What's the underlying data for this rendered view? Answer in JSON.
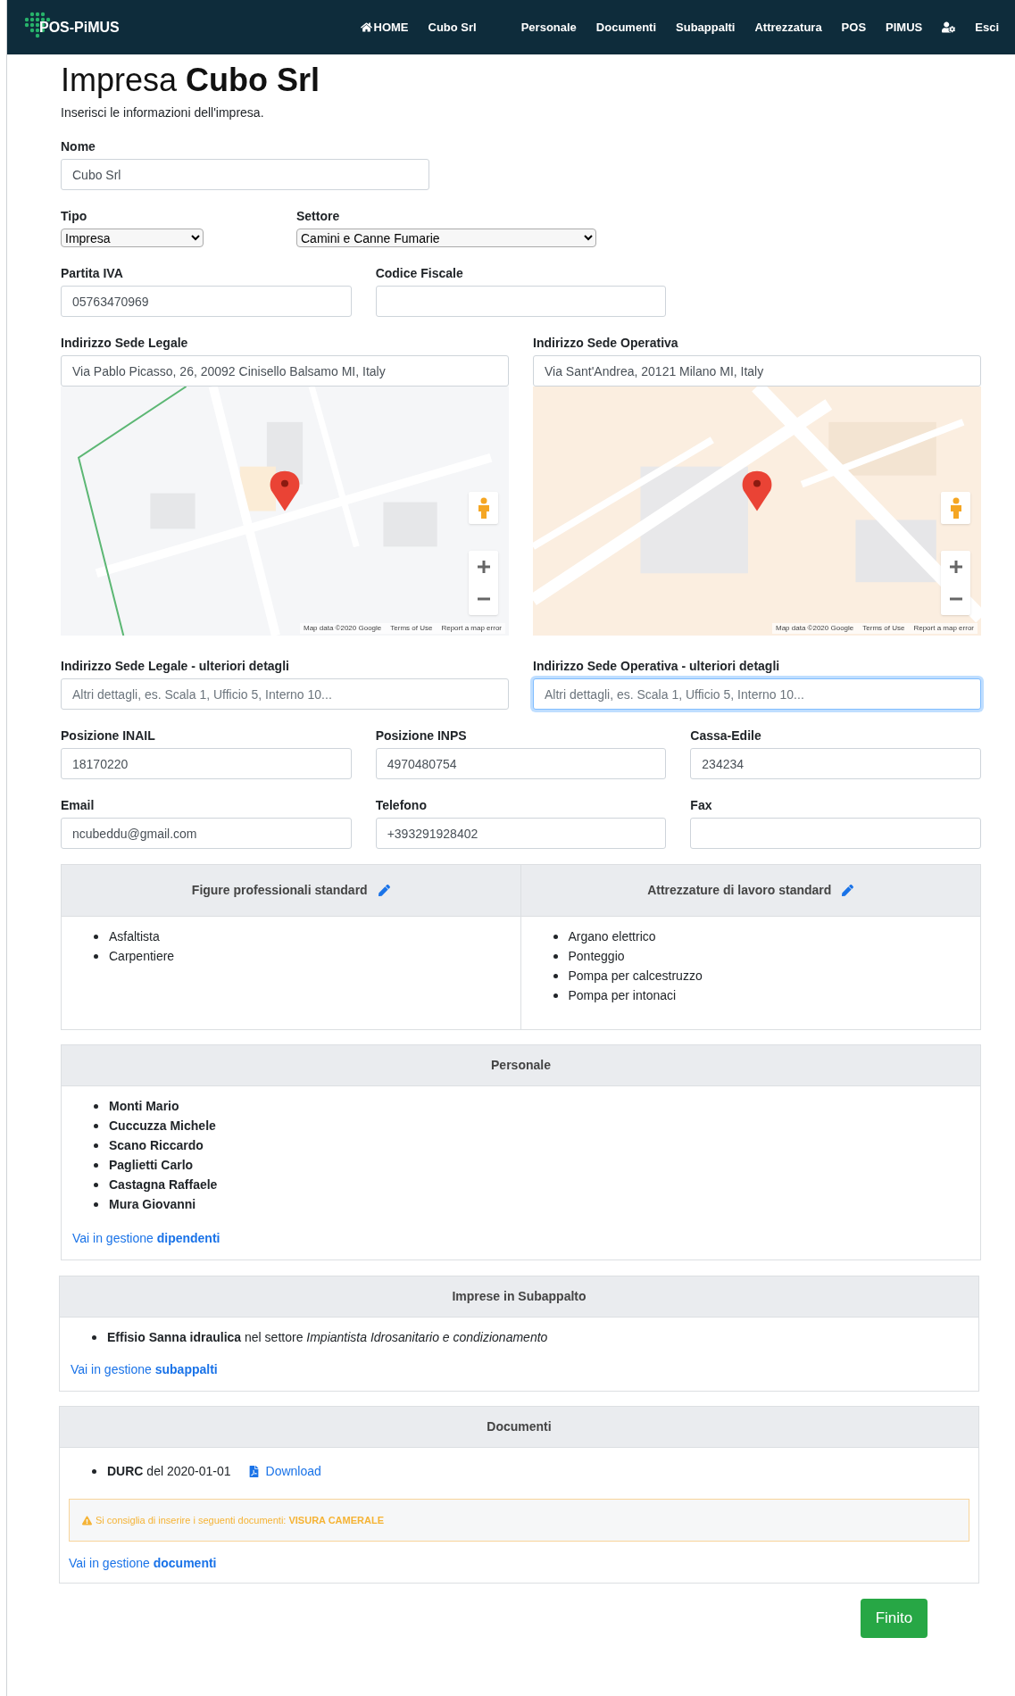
{
  "navbar": {
    "brand": "POS-PiMUS",
    "items": [
      {
        "kind": "home",
        "label": "HOME"
      },
      {
        "kind": "text",
        "label": "Cubo Srl"
      },
      {
        "kind": "text",
        "label": "Personale"
      },
      {
        "kind": "text",
        "label": "Documenti"
      },
      {
        "kind": "text",
        "label": "Subappalti"
      },
      {
        "kind": "text",
        "label": "Attrezzatura"
      },
      {
        "kind": "text",
        "label": "POS"
      },
      {
        "kind": "text",
        "label": "PIMUS"
      },
      {
        "kind": "user"
      },
      {
        "kind": "text",
        "label": "Esci"
      }
    ]
  },
  "header": {
    "title_prefix": "Impresa",
    "title_name": "Cubo Srl",
    "subtitle": "Inserisci le informazioni dell'impresa."
  },
  "nome": {
    "label": "Nome",
    "value": "Cubo Srl"
  },
  "tipo": {
    "label": "Tipo",
    "value": "Impresa"
  },
  "settore": {
    "label": "Settore",
    "value": "Camini e Canne Fumarie"
  },
  "row_fiscal": [
    {
      "label": "Partita IVA",
      "value": "05763470969"
    },
    {
      "label": "Codice Fiscale"
    }
  ],
  "addresses": [
    {
      "label": "Indirizzo Sede Legale",
      "value": "Via Pablo Picasso, 26, 20092 Cinisello Balsamo MI, Italy",
      "map": {
        "kind": "picture",
        "attribution": [
          "Map data ©2020 Google",
          "Terms of Use",
          "Report a map error"
        ]
      }
    },
    {
      "label": "Indirizzo Sede Operativa",
      "value": "Via Sant'Andrea, 20121 Milano MI, Italy",
      "map": {
        "kind": "picture",
        "attribution": [
          "Map data ©2020 Google",
          "Terms of Use",
          "Report a map error"
        ]
      }
    }
  ],
  "details": [
    {
      "label": "Indirizzo Sede Legale - ulteriori detagli",
      "placeholder": "Altri dettagli, es. Scala 1, Ufficio 5, Interno 10...",
      "focused": false
    },
    {
      "label": "Indirizzo Sede Operativa - ulteriori detagli",
      "placeholder": "Altri dettagli, es. Scala 1, Ufficio 5, Interno 10...",
      "focused": true
    }
  ],
  "row_positions": [
    {
      "label": "Posizione INAIL",
      "value": "18170220"
    },
    {
      "label": "Posizione INPS",
      "value": "4970480754"
    },
    {
      "label": "Cassa-Edile",
      "value": "234234"
    }
  ],
  "row_contacts": [
    {
      "label": "Email",
      "value": "ncubeddu@gmail.com"
    },
    {
      "label": "Telefono",
      "value": "+393291928402"
    },
    {
      "label": "Fax"
    }
  ],
  "standards": [
    {
      "title": "Figure professionali standard",
      "items": [
        "Asfaltista",
        "Carpentiere"
      ]
    },
    {
      "title": "Attrezzature di lavoro standard",
      "items": [
        "Argano elettrico",
        "Ponteggio",
        "Pompa per calcestruzzo",
        "Pompa per intonaci"
      ]
    }
  ],
  "personale": {
    "title": "Personale",
    "items": [
      "Monti Mario",
      "Cuccuzza Michele",
      "Scano Riccardo",
      "Paglietti Carlo",
      "Castagna Raffaele",
      "Mura Giovanni"
    ],
    "link": "Vai in gestione **dipendenti**"
  },
  "subappalto": {
    "title": "Imprese in Subappalto",
    "items": [
      "**Effisio Sanna idraulica** nel settore *Impiantista Idrosanitario e condizionamento*"
    ],
    "link": "Vai in gestione **subappalti**"
  },
  "documenti": {
    "title": "Documenti",
    "items": [
      {
        "text": "**DURC** del 2020-01-01",
        "download": "Download"
      }
    ],
    "warning": "Si consiglia di inserire i seguenti documenti: **VISURA CAMERALE**",
    "link": "Vai in gestione **documenti**"
  },
  "finish_button": "Finito"
}
